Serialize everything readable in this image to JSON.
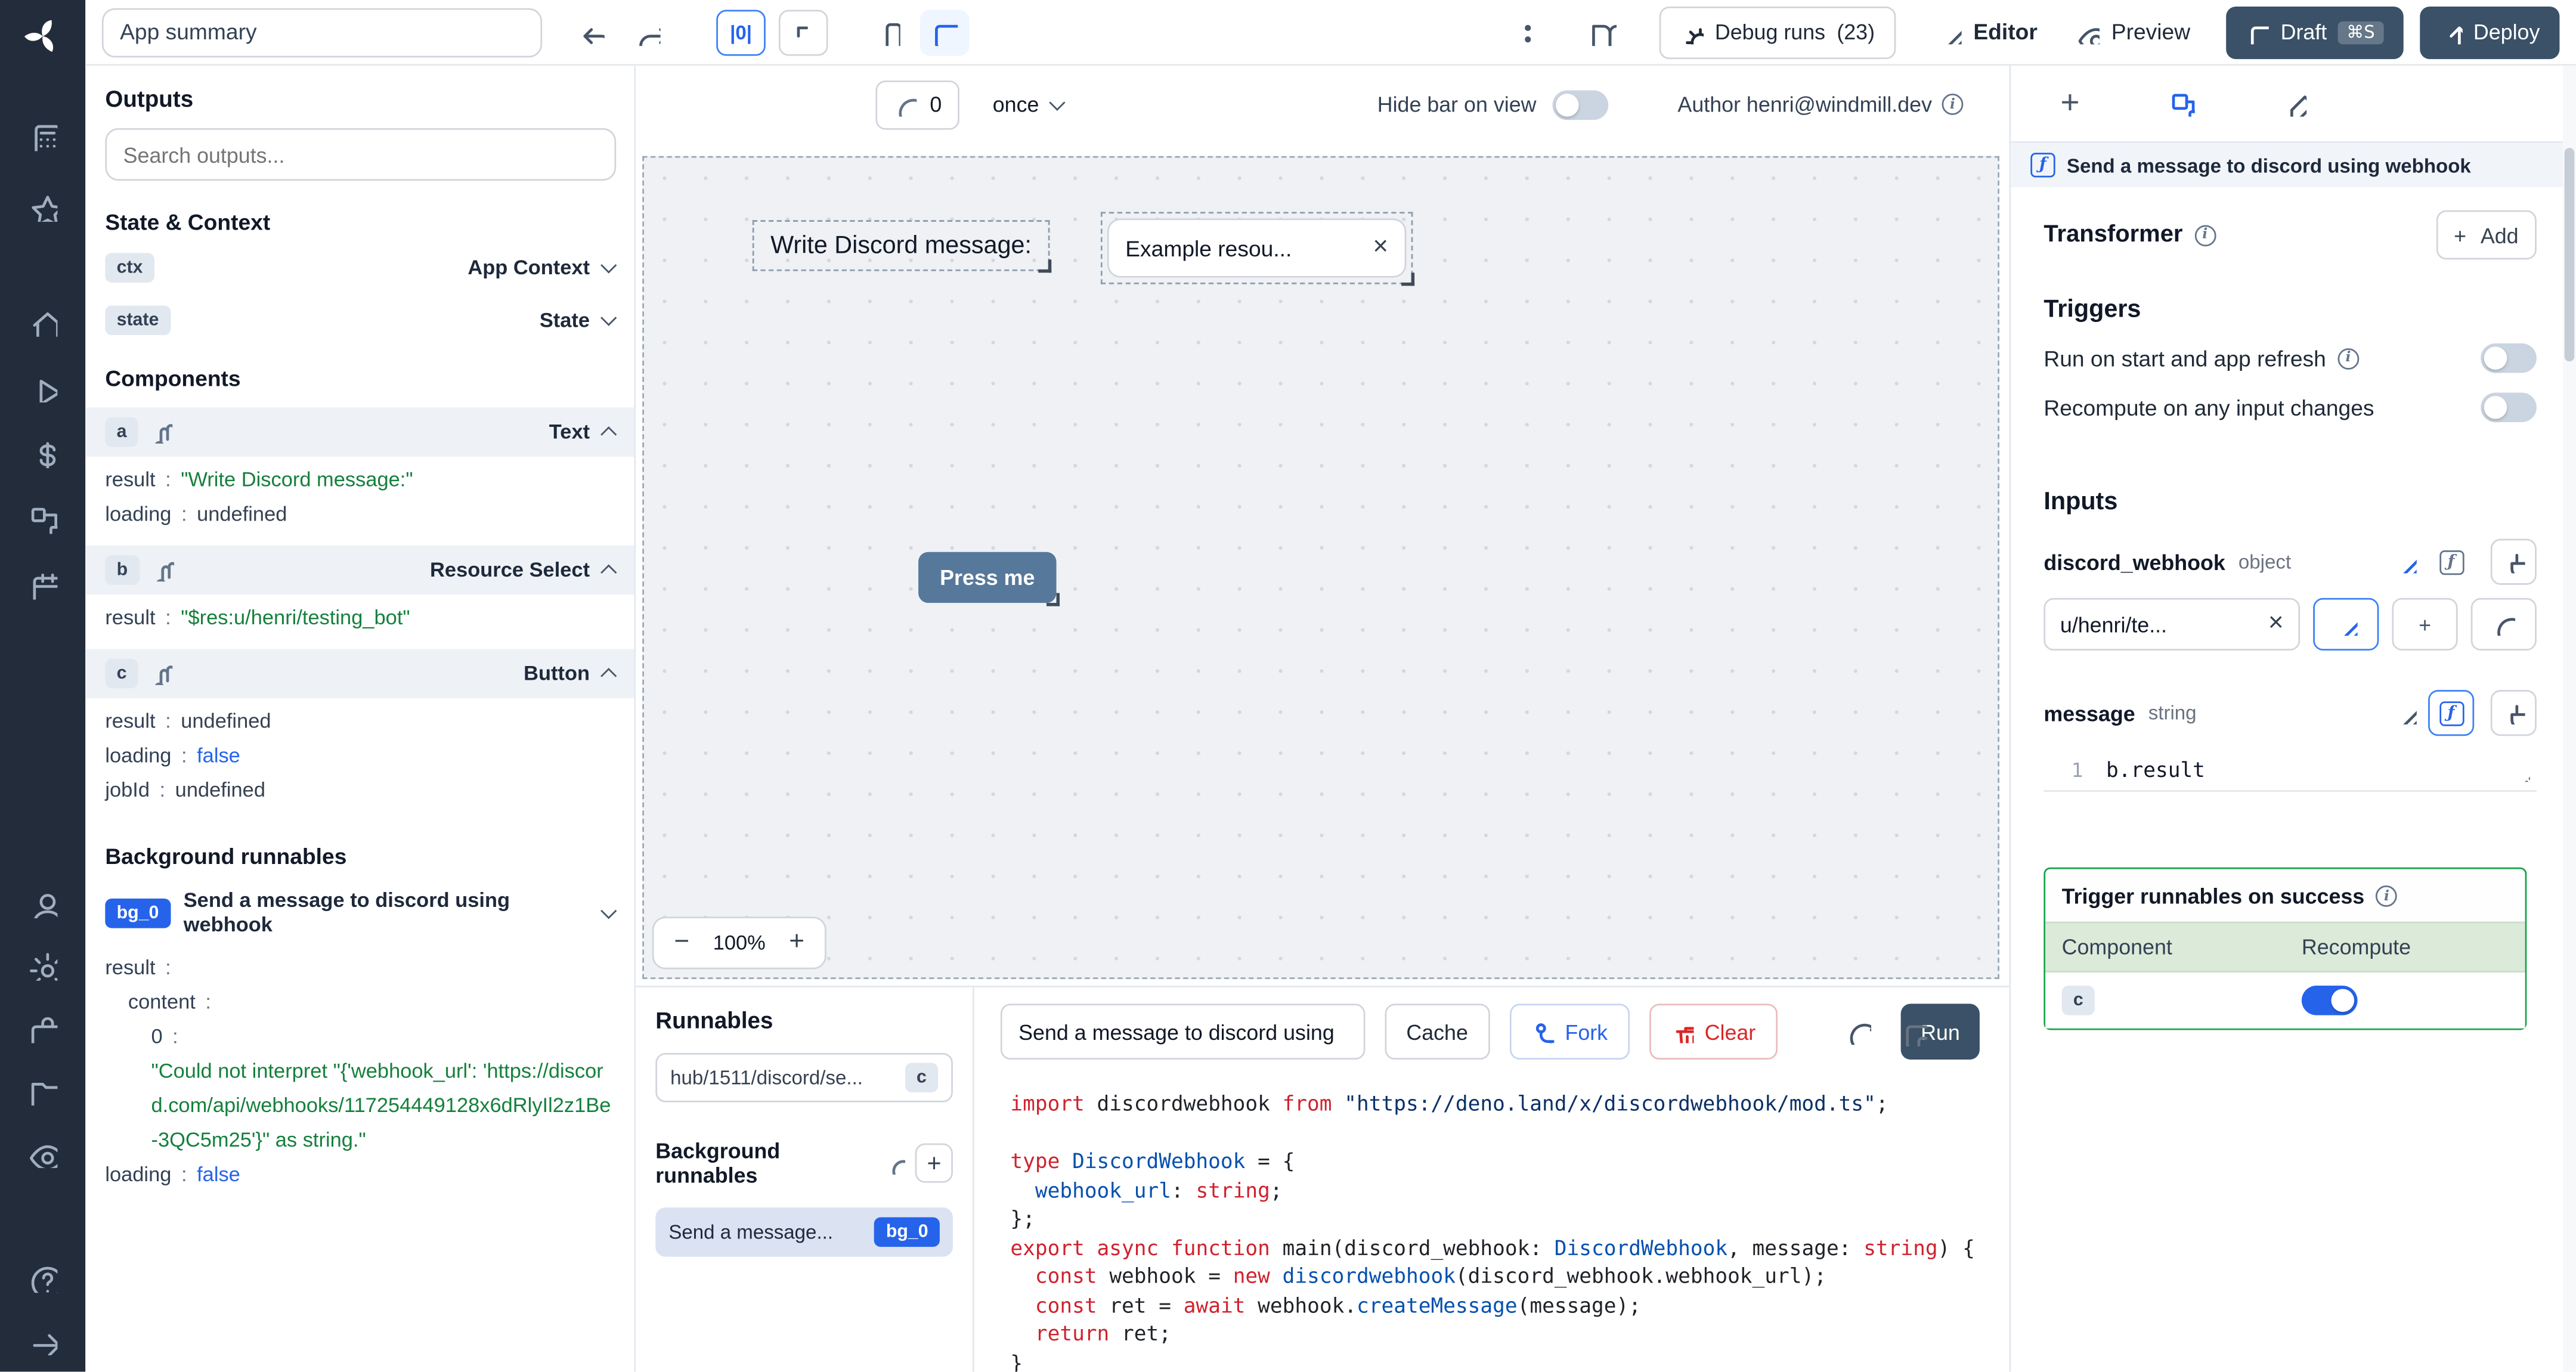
{
  "topbar": {
    "app_summary": "App summary",
    "align_button": "|0|",
    "debug_label": "Debug runs",
    "debug_count": "(23)",
    "editor_label": "Editor",
    "preview_label": "Preview",
    "draft_label": "Draft",
    "draft_shortcut": "⌘S",
    "deploy_label": "Deploy"
  },
  "sidebar": {
    "icons": [
      "apps",
      "star",
      "home",
      "runs-play",
      "variables-dollar",
      "resources",
      "schedules-calendar",
      "user",
      "settings-gear",
      "workers-toolbox",
      "folders",
      "audit-eye",
      "help",
      "collapse-arrow"
    ]
  },
  "outputs": {
    "title": "Outputs",
    "search_placeholder": "Search outputs...",
    "state_context_title": "State & Context",
    "ctx": {
      "badge": "ctx",
      "label": "App Context"
    },
    "state": {
      "badge": "state",
      "label": "State"
    },
    "components_title": "Components",
    "component_a": {
      "badge": "a",
      "type": "Text",
      "rows": [
        {
          "k": "result",
          "v": "\"Write Discord message:\"",
          "c": "str"
        },
        {
          "k": "loading",
          "v": "undefined",
          "c": "und"
        }
      ]
    },
    "component_b": {
      "badge": "b",
      "type": "Resource Select",
      "rows": [
        {
          "k": "result",
          "v": "\"$res:u/henri/testing_bot\"",
          "c": "str"
        }
      ]
    },
    "component_c": {
      "badge": "c",
      "type": "Button",
      "rows": [
        {
          "k": "result",
          "v": "undefined",
          "c": "und"
        },
        {
          "k": "loading",
          "v": "false",
          "c": "bool"
        },
        {
          "k": "jobId",
          "v": "undefined",
          "c": "und"
        }
      ]
    },
    "background_title": "Background runnables",
    "bg": {
      "badge": "bg_0",
      "name": "Send a message to discord using webhook",
      "rows": [
        {
          "k": "result"
        },
        {
          "k": "content",
          "ind": 1
        },
        {
          "k": "0",
          "ind": 2
        },
        {
          "v": "\"Could not interpret \"{'webhook_url': 'https://discord.com/api/webhooks/117254449128x6dRlyIl2z1Be-3QC5m25'}\" as string.\"",
          "c": "str",
          "ind": 2
        },
        {
          "k": "loading",
          "v": "false",
          "c": "bool"
        }
      ]
    }
  },
  "canvas": {
    "refresh_count": "0",
    "frequency": "once",
    "hide_bar_label": "Hide bar on view",
    "author": "Author henri@windmill.dev",
    "text_component": "Write Discord message:",
    "resource_value": "Example resou...",
    "button_label": "Press me",
    "zoom_out": "−",
    "zoom_level": "100%",
    "zoom_in": "+"
  },
  "runnables": {
    "title": "Runnables",
    "hub_item": "hub/1511/discord/se...",
    "hub_badge": "c",
    "bg_header": "Background runnables",
    "bg_item": "Send a message...",
    "bg_badge": "bg_0"
  },
  "script_editor": {
    "name": "Send a message to discord using",
    "cache_label": "Cache",
    "fork_label": "Fork",
    "clear_label": "Clear",
    "run_label": "Run",
    "lines": [
      [
        [
          "import",
          "k"
        ],
        [
          " discordwebhook ",
          "p"
        ],
        [
          "from",
          "k"
        ],
        [
          " ",
          "p"
        ],
        [
          "\"https://deno.land/x/discordwebhook/mod.ts\"",
          "s"
        ],
        [
          ";",
          "p"
        ]
      ],
      [],
      [
        [
          "type",
          "k"
        ],
        [
          " ",
          "p"
        ],
        [
          "DiscordWebhook",
          "t"
        ],
        [
          " = {",
          "p"
        ]
      ],
      [
        [
          "  ",
          "p"
        ],
        [
          "webhook_url",
          "t"
        ],
        [
          ": ",
          "p"
        ],
        [
          "string",
          "k"
        ],
        [
          ";",
          "p"
        ]
      ],
      [
        [
          "};",
          "p"
        ]
      ],
      [
        [
          "export",
          "k"
        ],
        [
          " ",
          "p"
        ],
        [
          "async",
          "k"
        ],
        [
          " ",
          "p"
        ],
        [
          "function",
          "k"
        ],
        [
          " main(discord_webhook: ",
          "p"
        ],
        [
          "DiscordWebhook",
          "t"
        ],
        [
          ", message: ",
          "p"
        ],
        [
          "string",
          "k"
        ],
        [
          ") {",
          "p"
        ]
      ],
      [
        [
          "  ",
          "p"
        ],
        [
          "const",
          "k"
        ],
        [
          " webhook = ",
          "p"
        ],
        [
          "new",
          "k"
        ],
        [
          " ",
          "p"
        ],
        [
          "discordwebhook",
          "t"
        ],
        [
          "(discord_webhook.webhook_url);",
          "p"
        ]
      ],
      [
        [
          "  ",
          "p"
        ],
        [
          "const",
          "k"
        ],
        [
          " ret = ",
          "p"
        ],
        [
          "await",
          "k"
        ],
        [
          " webhook.",
          "p"
        ],
        [
          "createMessage",
          "t"
        ],
        [
          "(message);",
          "p"
        ]
      ],
      [
        [
          "  ",
          "p"
        ],
        [
          "return",
          "k"
        ],
        [
          " ret;",
          "p"
        ]
      ],
      [
        [
          "}",
          "p"
        ]
      ]
    ]
  },
  "right_panel": {
    "header": "Send a message to discord using webhook",
    "transformer_label": "Transformer",
    "add_label": "Add",
    "triggers_title": "Triggers",
    "trigger_run_on_start": "Run on start and app refresh",
    "trigger_recompute": "Recompute on any input changes",
    "inputs_title": "Inputs",
    "input_webhook": {
      "name": "discord_webhook",
      "type": "object",
      "value": "u/henri/te..."
    },
    "input_message": {
      "name": "message",
      "type": "string",
      "line_number": "1",
      "expression": "b.result"
    },
    "success": {
      "title": "Trigger runnables on success",
      "col_component": "Component",
      "col_recompute": "Recompute",
      "row_component": "c"
    }
  },
  "colors": {
    "accent": "#2563eb",
    "dark_button": "#3a5167",
    "success_green": "#16a34a",
    "string_green": "#15803d",
    "keyword_red": "#cf222e"
  }
}
